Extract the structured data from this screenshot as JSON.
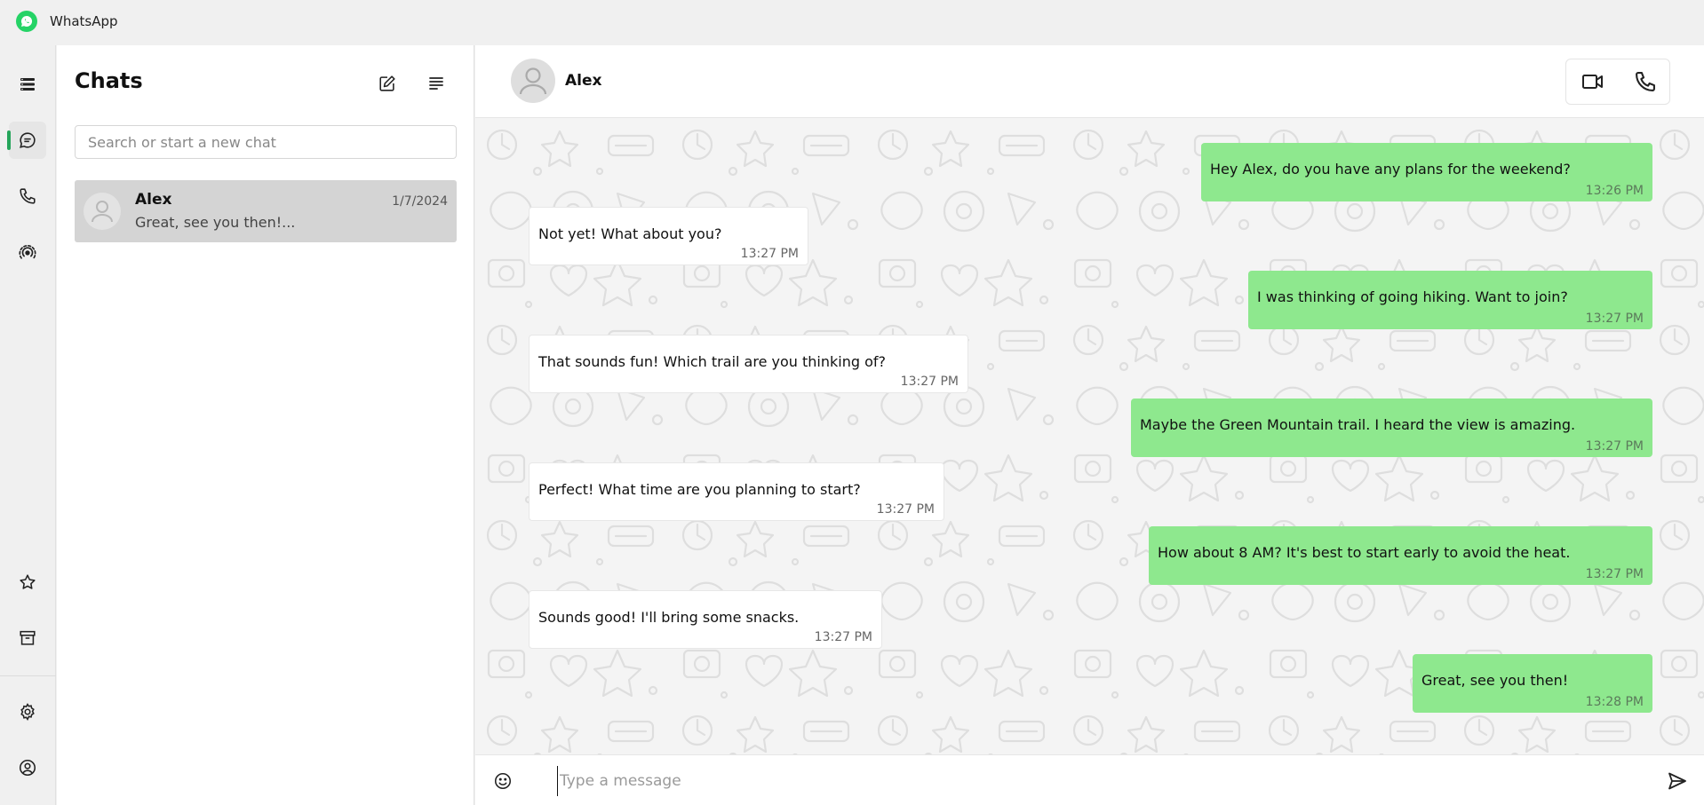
{
  "app": {
    "title": "WhatsApp",
    "brand_color": "#25d366"
  },
  "rail": {
    "items": [
      {
        "name": "menu-icon"
      },
      {
        "name": "chats-icon",
        "active": true
      },
      {
        "name": "calls-icon"
      },
      {
        "name": "status-icon"
      },
      {
        "name": "starred-icon"
      },
      {
        "name": "archive-icon"
      },
      {
        "name": "settings-icon"
      },
      {
        "name": "profile-icon"
      }
    ],
    "active_color": "#25a55a"
  },
  "chats_panel": {
    "title": "Chats",
    "search_placeholder": "Search or start a new chat",
    "items": [
      {
        "name": "Alex",
        "date": "1/7/2024",
        "preview": "Great, see you then!..."
      }
    ]
  },
  "conversation": {
    "contact_name": "Alex",
    "messages": [
      {
        "direction": "out",
        "text": "Hey Alex, do you have any plans for the weekend?",
        "time": "13:26 PM"
      },
      {
        "direction": "in",
        "text": "Not yet! What about you?",
        "time": "13:27 PM"
      },
      {
        "direction": "out",
        "text": "I was thinking of going hiking. Want to join?",
        "time": "13:27 PM"
      },
      {
        "direction": "in",
        "text": "That sounds fun! Which trail are you thinking of?",
        "time": "13:27 PM"
      },
      {
        "direction": "out",
        "text": "Maybe the Green Mountain trail. I heard the view is amazing.",
        "time": "13:27 PM"
      },
      {
        "direction": "in",
        "text": "Perfect! What time are you planning to start?",
        "time": "13:27 PM"
      },
      {
        "direction": "out",
        "text": "How about 8 AM? It's best to start early to avoid the heat.",
        "time": "13:27 PM"
      },
      {
        "direction": "in",
        "text": "Sounds good! I'll bring some snacks.",
        "time": "13:27 PM"
      },
      {
        "direction": "out",
        "text": "Great, see you then!",
        "time": "13:28 PM"
      }
    ],
    "outgoing_bubble_color": "#8ee88e",
    "incoming_bubble_color": "#ffffff"
  },
  "composer": {
    "placeholder": "Type a message",
    "value": ""
  }
}
